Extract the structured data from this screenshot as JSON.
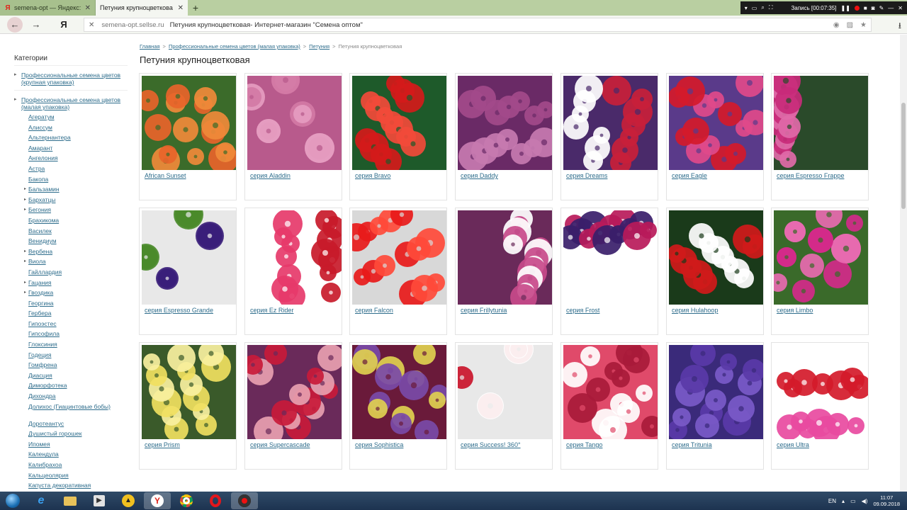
{
  "tabs": [
    {
      "title": "semena-opt — Яндекс: на",
      "active": false
    },
    {
      "title": "Петуния крупноцветкова",
      "active": true
    }
  ],
  "recorder": {
    "label": "Запись [00:07:35]"
  },
  "address": {
    "host": "semena-opt.sellse.ru",
    "title": "Петуния крупноцветковая- Интернет-магазин \"Семена оптом\""
  },
  "sidebar": {
    "heading": "Категории",
    "groups": [
      {
        "label": "Профессиональные семена цветов (крупная упаковка)"
      },
      {
        "label": "Профессиональные семена цветов (малая упаковка)"
      }
    ],
    "items": [
      {
        "label": "Агератум",
        "arrow": false
      },
      {
        "label": "Алиссум",
        "arrow": false
      },
      {
        "label": "Альтернантера",
        "arrow": false
      },
      {
        "label": "Амарант",
        "arrow": false
      },
      {
        "label": "Ангелония",
        "arrow": false
      },
      {
        "label": "Астра",
        "arrow": false
      },
      {
        "label": "Бакопа",
        "arrow": false
      },
      {
        "label": "Бальзамин",
        "arrow": true
      },
      {
        "label": "Бархатцы",
        "arrow": true
      },
      {
        "label": "Бегония",
        "arrow": true
      },
      {
        "label": "Брахикома",
        "arrow": false
      },
      {
        "label": "Василек",
        "arrow": false
      },
      {
        "label": "Венидиум",
        "arrow": false
      },
      {
        "label": "Вербена",
        "arrow": true
      },
      {
        "label": "Виола",
        "arrow": true
      },
      {
        "label": "Гайллардия",
        "arrow": false
      },
      {
        "label": "Гацания",
        "arrow": true
      },
      {
        "label": "Гвоздика",
        "arrow": true
      },
      {
        "label": "Георгина",
        "arrow": false
      },
      {
        "label": "Гербера",
        "arrow": false
      },
      {
        "label": "Гипоэстес",
        "arrow": false
      },
      {
        "label": "Гипсофила",
        "arrow": false
      },
      {
        "label": "Глоксиния",
        "arrow": false
      },
      {
        "label": "Годеция",
        "arrow": false
      },
      {
        "label": "Гомфрена",
        "arrow": false
      },
      {
        "label": "Диасция",
        "arrow": false
      },
      {
        "label": "Диморфотека",
        "arrow": false
      },
      {
        "label": "Дихондра",
        "arrow": false
      },
      {
        "label": "Долихос (Гиацинтовые бобы)",
        "arrow": false,
        "two": true
      },
      {
        "label": "Доротеантус",
        "arrow": false
      },
      {
        "label": "Душистый горошек",
        "arrow": false
      },
      {
        "label": "Ипомея",
        "arrow": false
      },
      {
        "label": "Календула",
        "arrow": false
      },
      {
        "label": "Калибрахоа",
        "arrow": false
      },
      {
        "label": "Кальцеолярия",
        "arrow": false
      },
      {
        "label": "Капуста декоративная",
        "arrow": false
      }
    ]
  },
  "breadcrumb": [
    {
      "label": "Главная",
      "link": true
    },
    {
      "label": "Профессиональные семена цветов (малая упаковка)",
      "link": true
    },
    {
      "label": "Петуния",
      "link": true
    },
    {
      "label": "Петуния крупноцветковая",
      "link": false
    }
  ],
  "page_title": "Петуния крупноцветковая",
  "products": [
    {
      "label": "African Sunset",
      "colors": [
        "#e8642a",
        "#f08a3a",
        "#3b6b2a"
      ]
    },
    {
      "label": "серия Aladdin",
      "colors": [
        "#d37aa5",
        "#e59cc0",
        "#b85a8c"
      ]
    },
    {
      "label": "серия Bravo",
      "colors": [
        "#d41a1a",
        "#f24a3a",
        "#1e5a2a"
      ]
    },
    {
      "label": "серия Daddy",
      "colors": [
        "#a34a8a",
        "#c77ab0",
        "#6a2a66"
      ]
    },
    {
      "label": "серия Dreams",
      "colors": [
        "#c81f3a",
        "#ffffff",
        "#4a2a6a"
      ]
    },
    {
      "label": "серия Eagle",
      "colors": [
        "#e04a8a",
        "#d41a2a",
        "#5a3a8a"
      ]
    },
    {
      "label": "серия Espresso Frappe",
      "colors": [
        "#c82a7a",
        "#e06aa8",
        "#2a4a2a"
      ]
    },
    {
      "label": "серия Espresso Grande",
      "colors": [
        "#3a1e7a",
        "#4a8a2a",
        "#e8e8e8"
      ]
    },
    {
      "label": "серия Ez Rider",
      "colors": [
        "#e63a6a",
        "#c81a2a",
        "#ffffff"
      ]
    },
    {
      "label": "серия Falcon",
      "colors": [
        "#e81a1a",
        "#ff4a3a",
        "#d8d8d8"
      ]
    },
    {
      "label": "серия Frillytunia",
      "colors": [
        "#c84a8a",
        "#ffffff",
        "#6a2a5a"
      ]
    },
    {
      "label": "серия Frost",
      "colors": [
        "#b81a5a",
        "#3a1e6a",
        "#ffffff"
      ]
    },
    {
      "label": "серия Hulahoop",
      "colors": [
        "#d01a1a",
        "#ffffff",
        "#1a3a1a"
      ]
    },
    {
      "label": "серия Limbo",
      "colors": [
        "#d42a8a",
        "#e86ab0",
        "#3a6a2a"
      ]
    },
    {
      "label": "серия Prism",
      "colors": [
        "#f0e060",
        "#f8f0a0",
        "#3a5a2a"
      ]
    },
    {
      "label": "серия Supercascade",
      "colors": [
        "#c81a3a",
        "#e8a0b0",
        "#6a2a5a"
      ]
    },
    {
      "label": "серия Sophistica",
      "colors": [
        "#7a4aa8",
        "#e0d050",
        "#6a1a3a"
      ]
    },
    {
      "label": "серия Success! 360°",
      "colors": [
        "#c8142a",
        "#ffffff",
        "#e8e8e8"
      ]
    },
    {
      "label": "серия Tango",
      "colors": [
        "#a81a3a",
        "#ffffff",
        "#e04a6a"
      ]
    },
    {
      "label": "серия Tritunia",
      "colors": [
        "#5a3aa8",
        "#7a5ac8",
        "#3a2a7a"
      ]
    },
    {
      "label": "серия Ultra",
      "colors": [
        "#d41a2a",
        "#e84aa0",
        "#ffffff"
      ]
    }
  ],
  "taskbar": {
    "lang": "EN",
    "time": "11:07",
    "date": "09.09.2018"
  }
}
